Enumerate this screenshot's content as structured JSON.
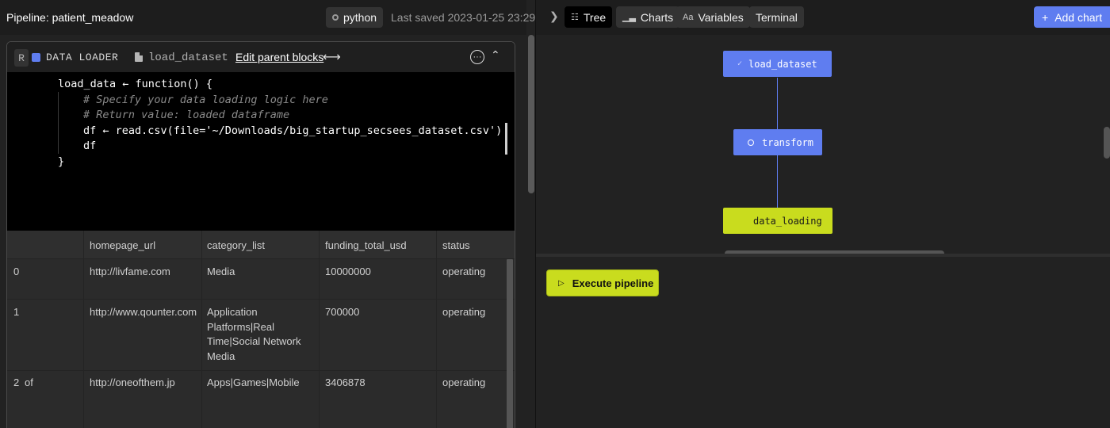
{
  "header": {
    "pipeline_title": "Pipeline: patient_meadow",
    "language": "python",
    "last_saved": "Last saved 2023-01-25 23:29"
  },
  "block": {
    "r_label": "R",
    "type": "DATA LOADER",
    "file": "load_dataset",
    "edit_parents": "Edit parent blocks",
    "edit_arrows": "⟷",
    "more": "···",
    "collapse": "⌃",
    "code": [
      "load_data ← function() {",
      "# Specify your data loading logic here",
      "# Return value: loaded dataframe",
      "df ← read.csv(file='~/Downloads/big_startup_secsees_dataset.csv')",
      "df",
      "}"
    ]
  },
  "table": {
    "columns": [
      "",
      "homepage_url",
      "category_list",
      "funding_total_usd",
      "status"
    ],
    "rows": [
      {
        "index": "0",
        "extra": "",
        "homepage_url": "http://livfame.com",
        "category_list": "Media",
        "funding_total_usd": "10000000",
        "status": "operating"
      },
      {
        "index": "1",
        "extra": "",
        "homepage_url": "http://www.qounter.com",
        "category_list": "Application Platforms|Real Time|Social Network Media",
        "funding_total_usd": "700000",
        "status": "operating"
      },
      {
        "index": "2",
        "extra": "of",
        "homepage_url": "http://oneofthem.jp",
        "category_list": "Apps|Games|Mobile",
        "funding_total_usd": "3406878",
        "status": "operating"
      }
    ]
  },
  "right": {
    "tabs": [
      {
        "label": "Tree",
        "icon": "tree-icon"
      },
      {
        "label": "Charts",
        "icon": "chart-icon"
      },
      {
        "label": "Variables",
        "icon": "variables-icon"
      },
      {
        "label": "Terminal",
        "icon": ""
      }
    ],
    "add_chart": "Add chart",
    "nodes": [
      {
        "label": "load_dataset"
      },
      {
        "label": "transform"
      },
      {
        "label": "data_loading"
      }
    ],
    "execute": "Execute pipeline"
  },
  "colors": {
    "accent_blue": "#5f7df0",
    "accent_yellow": "#c9dc1e",
    "background": "#222222"
  }
}
